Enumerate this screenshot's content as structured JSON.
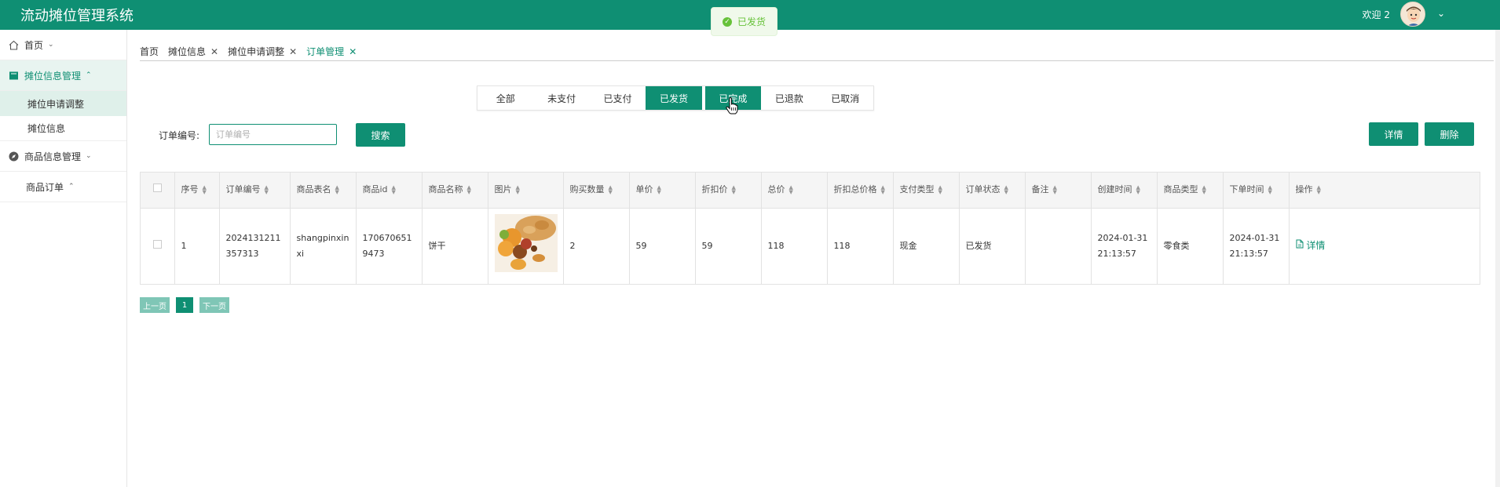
{
  "app": {
    "title": "流动摊位管理系统",
    "welcome": "欢迎 2",
    "accent_color": "#0f8f73"
  },
  "toast": {
    "text": "已发货"
  },
  "sidebar": {
    "home": "首页",
    "stall_group": "摊位信息管理",
    "stall_sub_1": "摊位申请调整",
    "stall_sub_2": "摊位信息",
    "goods_group": "商品信息管理",
    "goods_order": "商品订单"
  },
  "tabs": [
    "首页",
    "摊位信息",
    "摊位申请调整",
    "订单管理"
  ],
  "filter_tabs": [
    "全部",
    "未支付",
    "已支付",
    "已发货",
    "已完成",
    "已退款",
    "已取消"
  ],
  "search": {
    "label": "订单编号:",
    "placeholder": "订单编号",
    "button": "搜索"
  },
  "actions": {
    "detail": "详情",
    "delete": "删除"
  },
  "table": {
    "columns": [
      "序号",
      "订单编号",
      "商品表名",
      "商品id",
      "商品名称",
      "图片",
      "购买数量",
      "单价",
      "折扣价",
      "总价",
      "折扣总价格",
      "支付类型",
      "订单状态",
      "备注",
      "创建时间",
      "商品类型",
      "下单时间",
      "操作"
    ],
    "row": {
      "index": "1",
      "order_no": "2024131211357313",
      "table_name": "shangpinxinxi",
      "goods_id": "1706706519473",
      "goods_name": "饼干",
      "quantity": "2",
      "price": "59",
      "discount_price": "59",
      "total": "118",
      "discount_total": "118",
      "pay_type": "现金",
      "status": "已发货",
      "remark": "",
      "created": "2024-01-31 21:13:57",
      "category": "零食类",
      "order_time": "2024-01-31 21:13:57",
      "op": "详情"
    }
  },
  "pager": {
    "prev": "上一页",
    "current": "1",
    "next": "下一页"
  }
}
